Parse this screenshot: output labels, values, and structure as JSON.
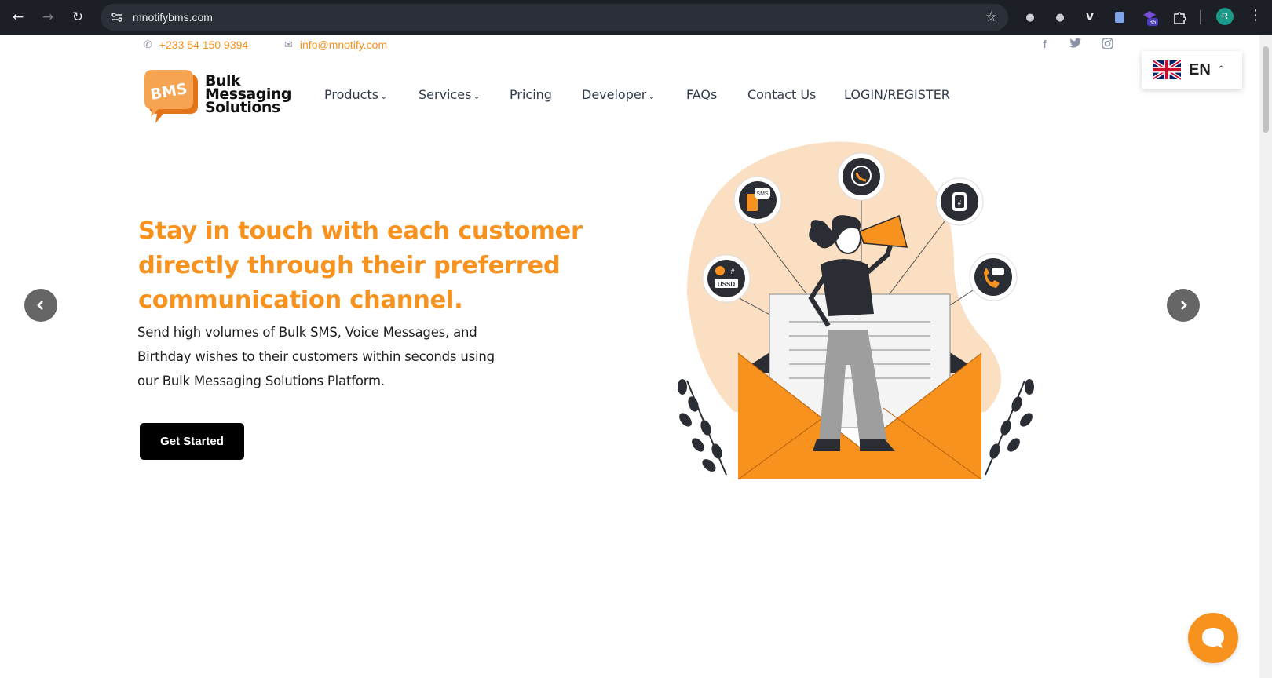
{
  "browser": {
    "url": "mnotifybms.com",
    "extension_badge": "36",
    "profile_initial": "R"
  },
  "topbar": {
    "phone": "+233 54 150 9394",
    "email": "info@mnotify.com",
    "social": [
      "facebook-icon",
      "twitter-icon",
      "instagram-icon"
    ]
  },
  "language": {
    "code": "EN",
    "flag": "uk-flag-icon"
  },
  "logo": {
    "badge": "BMS",
    "line1": "Bulk",
    "line2": "Messaging",
    "line3": "Solutions"
  },
  "nav": {
    "products": "Products",
    "services": "Services",
    "pricing": "Pricing",
    "developer": "Developer",
    "faqs": "FAQs",
    "contact": "Contact Us",
    "login": "LOGIN/REGISTER"
  },
  "hero": {
    "title": "Stay in touch with each customer directly through their preferred communication channel.",
    "text": "Send high volumes of Bulk SMS, Voice Messages, and Birthday wishes to their customers within seconds using our Bulk Messaging Solutions Platform.",
    "cta": "Get Started"
  },
  "illustration": {
    "sms_label": "SMS",
    "ussd_label": "USSD",
    "hash_label": "#"
  },
  "colors": {
    "brand_orange": "#f7921e",
    "nav_text": "#2f3b4c",
    "chrome_bg": "#1c1f26",
    "dark_icon": "#2a2d33"
  }
}
